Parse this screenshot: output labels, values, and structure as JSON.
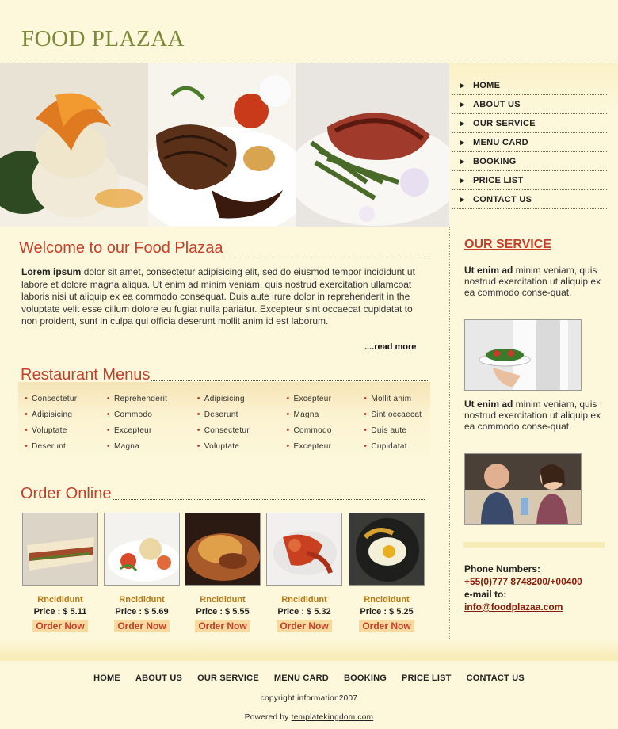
{
  "site": {
    "logo": "FOOD PLAZAA"
  },
  "nav": [
    {
      "label": "HOME"
    },
    {
      "label": "ABOUT US"
    },
    {
      "label": "OUR SERVICE"
    },
    {
      "label": "MENU CARD"
    },
    {
      "label": "BOOKING"
    },
    {
      "label": "PRICE LIST"
    },
    {
      "label": "CONTACT US"
    }
  ],
  "welcome": {
    "heading": "Welcome to our Food Plazaa",
    "lead": "Lorem ipsum",
    "body": " dolor sit amet, consectetur adipisicing elit, sed do eiusmod tempor incididunt ut labore et dolore magna aliqua. Ut enim ad minim veniam, quis nostrud exercitation ullamcoat laboris nisi ut aliquip ex ea commodo consequat. Duis aute irure dolor in reprehenderit in the voluptate velit esse cillum dolore eu fugiat nulla pariatur. Excepteur sint occaecat cupidatat to non proident, sunt in culpa qui officia deserunt mollit anim id est laborum.",
    "read_more": "....read more"
  },
  "menus": {
    "heading": "Restaurant Menus",
    "columns": [
      [
        "Consectetur",
        "Adipisicing",
        "Voluptate",
        "Deserunt"
      ],
      [
        "Reprehenderit",
        "Commodo",
        "Excepteur",
        "Magna"
      ],
      [
        "Adipisicing",
        "Deserunt",
        "Consectetur",
        "Voluptate"
      ],
      [
        "Excepteur",
        "Magna",
        "Commodo",
        "Excepteur"
      ],
      [
        "Mollit anim",
        "Sint occaecat",
        "Duis aute",
        "Cupidatat"
      ]
    ]
  },
  "order": {
    "heading": "Order Online",
    "products": [
      {
        "name": "Rncididunt",
        "price": "Price : $ 5.11",
        "button": "Order Now"
      },
      {
        "name": "Rncididunt",
        "price": "Price : $ 5.69",
        "button": "Order Now"
      },
      {
        "name": "Rncididunt",
        "price": "Price : $ 5.55",
        "button": "Order Now"
      },
      {
        "name": "Rncididunt",
        "price": "Price : $ 5.32",
        "button": "Order Now"
      },
      {
        "name": "Rncididunt",
        "price": "Price : $ 5.25",
        "button": "Order Now"
      }
    ]
  },
  "service": {
    "heading": "OUR SERVICE",
    "blocks": [
      {
        "lead": "Ut enim ad",
        "text": " minim veniam, quis nostrud exercitation  ut aliquip ex ea commodo conse-quat."
      },
      {
        "lead": "Ut enim ad",
        "text": " minim veniam, quis nostrud exercitation  ut aliquip ex ea commodo conse-quat."
      }
    ]
  },
  "contact": {
    "phone_label": "Phone Numbers:",
    "phone": "+55(0)777 8748200/+00400",
    "email_label": "e-mail to:",
    "email": "info@foodplazaa.com"
  },
  "footer": {
    "nav": [
      "HOME",
      "ABOUT US",
      "OUR SERVICE",
      "MENU CARD",
      "BOOKING",
      "PRICE LIST",
      "CONTACT US"
    ],
    "copyright": "copyright information2007",
    "powered_prefix": "Powered by ",
    "powered_link": "templatekingdom.com"
  }
}
